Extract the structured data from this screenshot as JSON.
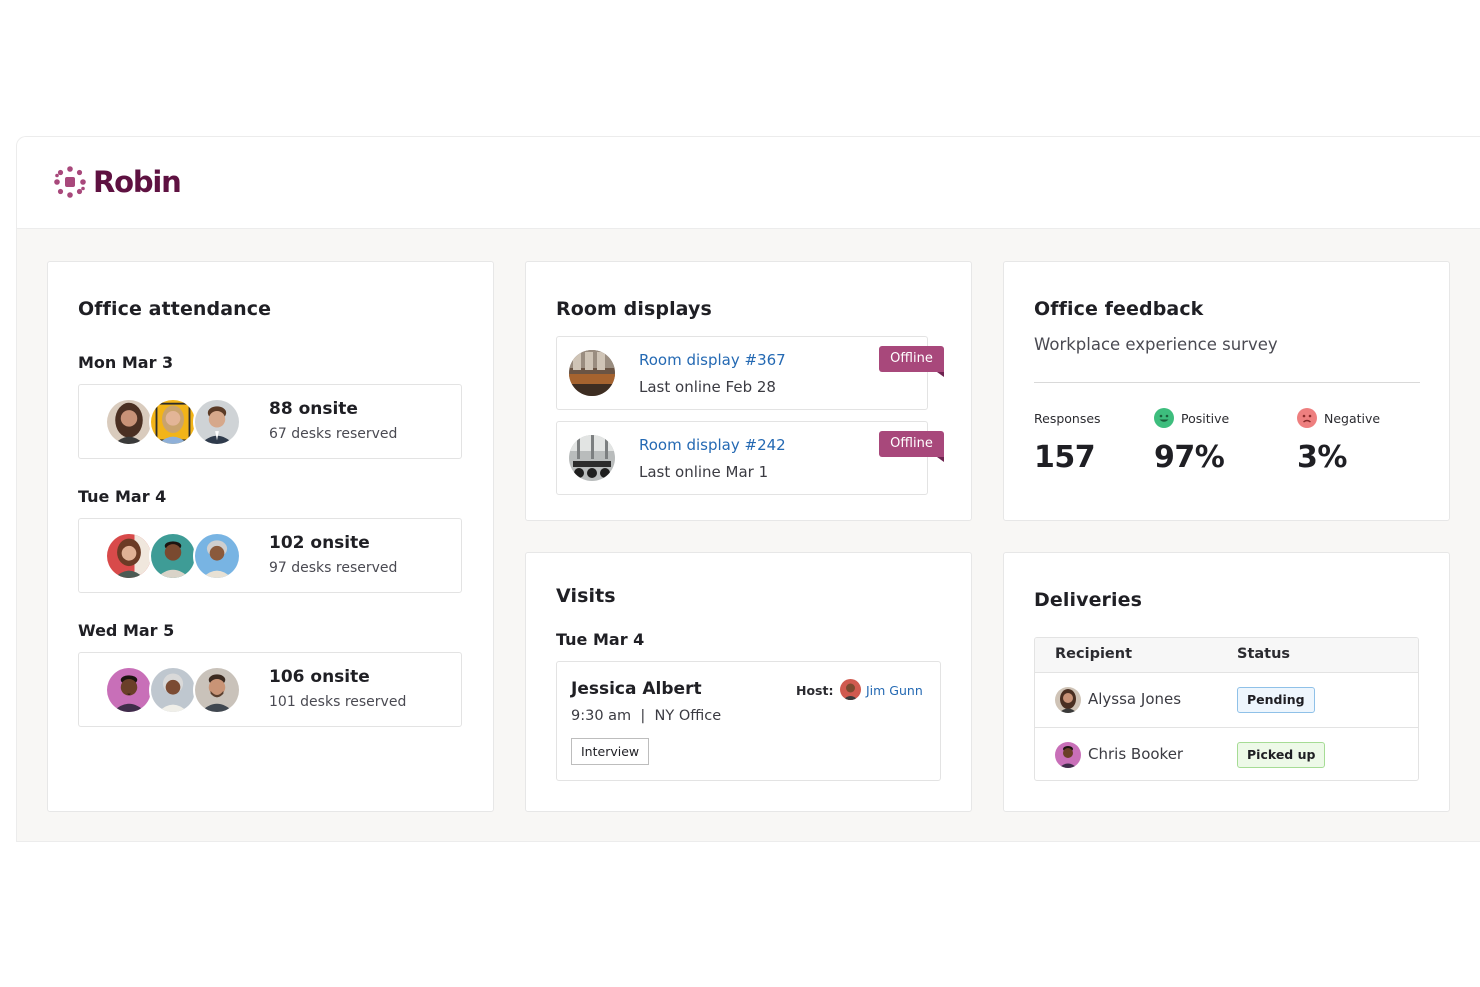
{
  "brand": {
    "name": "Robin",
    "color": "#5e1141",
    "accent": "#a8487b"
  },
  "attendance": {
    "title": "Office attendance",
    "days": [
      {
        "day": "Mon Mar 3",
        "onsite": "88 onsite",
        "desks": "67 desks reserved"
      },
      {
        "day": "Tue Mar 4",
        "onsite": "102 onsite",
        "desks": "97 desks reserved"
      },
      {
        "day": "Wed Mar 5",
        "onsite": "106 onsite",
        "desks": "101 desks reserved"
      }
    ]
  },
  "rooms": {
    "title": "Room displays",
    "items": [
      {
        "name": "Room display #367",
        "last": "Last online Feb 28",
        "status": "Offline"
      },
      {
        "name": "Room display #242",
        "last": "Last online Mar 1",
        "status": "Offline"
      }
    ]
  },
  "feedback": {
    "title": "Office feedback",
    "survey": "Workplace experience survey",
    "responses_label": "Responses",
    "responses": "157",
    "positive_label": "Positive",
    "positive": "97%",
    "negative_label": "Negative",
    "negative": "3%"
  },
  "visits": {
    "title": "Visits",
    "day": "Tue Mar 4",
    "visitor": "Jessica Albert",
    "meta": "9:30 am  |  NY Office",
    "tag": "Interview",
    "host_label": "Host:",
    "host": "Jim Gunn"
  },
  "deliveries": {
    "title": "Deliveries",
    "col_recipient": "Recipient",
    "col_status": "Status",
    "rows": [
      {
        "name": "Alyssa Jones",
        "status": "Pending"
      },
      {
        "name": "Chris Booker",
        "status": "Picked up"
      }
    ]
  },
  "icons": {
    "logo": "robin-logo-icon",
    "positive": "smiley-face-icon",
    "negative": "frown-face-icon"
  }
}
